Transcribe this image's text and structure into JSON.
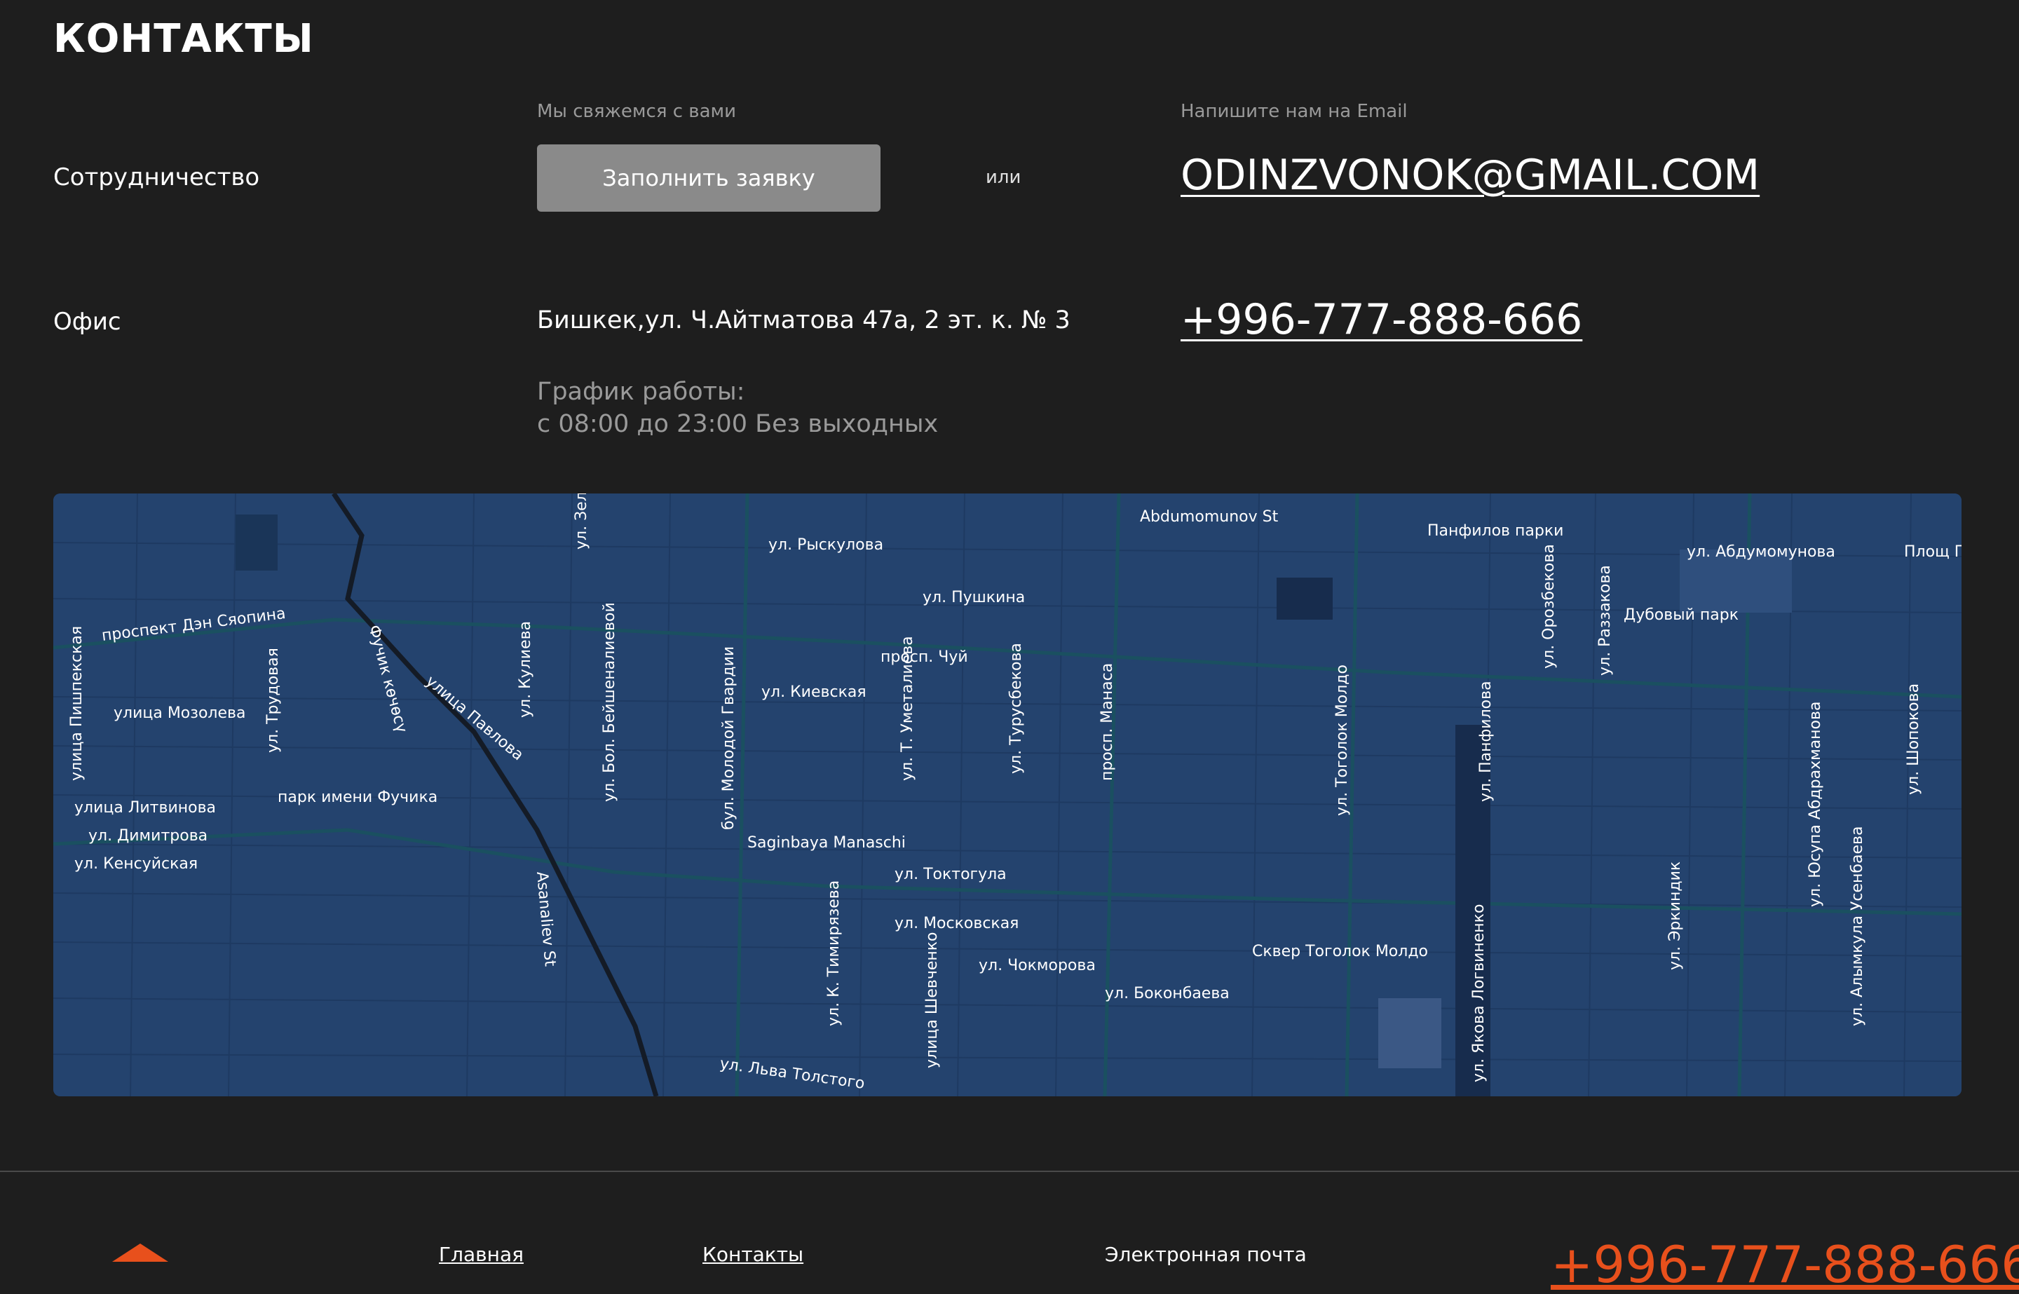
{
  "page": {
    "title": "КОНТАКТЫ"
  },
  "cooperation": {
    "label": "Сотрудничество",
    "hint": "Мы свяжемся с вами",
    "button_label": "Заполнить заявку",
    "or_text": "или",
    "email_hint": "Напишите нам на Email",
    "email": "ODINZVONOK@GMAIL.COM"
  },
  "office": {
    "label": "Офис",
    "address": "Бишкек,ул. Ч.Айтматова 47а, 2 эт. к. № 3",
    "hours_title": "График работы:",
    "hours_value": "с 08:00 до 23:00 Без выходных",
    "phone": "+996-777-888-666"
  },
  "map": {
    "accent_color": "#24436e",
    "labels": [
      "проспект Дэн Сяопина",
      "просп. Чуй",
      "ул. Рыскулова",
      "ул. Пушкина",
      "ул. Зеленая",
      "улица Пишпекская",
      "улица Мозолева",
      "ул. Трудовая",
      "Фучик көчөсү",
      "улица Павлова",
      "ул. Кулиева",
      "ул. Бол. Бейшеналиевой",
      "бул. Молодой Гвардии",
      "ул. Киевская",
      "улица Литвинова",
      "ул. Димитрова",
      "ул. Кенсуйская",
      "парк имени Фучика",
      "ул. Московская",
      "ул. Токтогула",
      "Asanaliev St",
      "ул. Т. Уметалиева",
      "ул. Турусбекова",
      "Saginbaya Manaschi",
      "ул. К. Тимирязева",
      "улица Шевченко",
      "ул. Чокморова",
      "просп. Манаса",
      "ул. Боконбаева",
      "ул. Льва Толстого",
      "Abdumomunov St",
      "Панфилов парки",
      "ул. Абдумомунова",
      "Дубовый парк",
      "ул. Тоголок Молдо",
      "ул. Панфилова",
      "ул. Орозбекова",
      "ул. Раззакова",
      "ул. Эркиндик",
      "ул. Юсупа Абдрахманова",
      "ул. Шопокова",
      "ул. Алымкула Усенбаева",
      "Сквер Тоголок Молдо",
      "ул. Якова Логвиненко",
      "Площ Побе"
    ]
  },
  "footer": {
    "nav_home": "Главная",
    "nav_contacts": "Контакты",
    "email_label": "Электронная почта",
    "phone": "+996-777-888-666",
    "accent_color": "#e8501c"
  }
}
